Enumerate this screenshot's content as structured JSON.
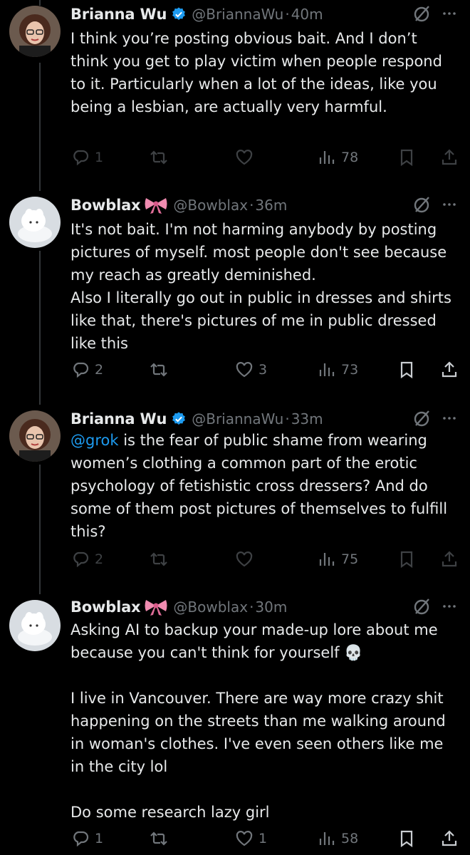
{
  "tweets": [
    {
      "name": "Brianna Wu",
      "verified": true,
      "bow": false,
      "handle": "@BriannaWu",
      "separator": "·",
      "time": "40m",
      "mention": "",
      "text": "I think you’re posting obvious bait. And I don’t think you get to play victim when people respond to it. Particularly when a lot of the ideas, like you being a lesbian, are actually very harmful.",
      "replies": "1",
      "retweets": "",
      "likes": "",
      "views": "78"
    },
    {
      "name": "Bowblax",
      "verified": false,
      "bow": true,
      "handle": "@Bowblax",
      "separator": "·",
      "time": "36m",
      "mention": "",
      "text": "It's not bait. I'm not harming anybody by posting pictures of myself. most people don't see because my reach as greatly deminished.\nAlso I literally go out in public in dresses and shirts like that, there's pictures of me in public dressed like this",
      "replies": "2",
      "retweets": "",
      "likes": "3",
      "views": "73"
    },
    {
      "name": "Brianna Wu",
      "verified": true,
      "bow": false,
      "handle": "@BriannaWu",
      "separator": "·",
      "time": "33m",
      "mention": "@grok",
      "text": " is the fear of public shame from wearing women’s clothing a common part of the erotic psychology of fetishistic cross dressers? And do some of them post pictures of themselves to fulfill this?",
      "replies": "2",
      "retweets": "",
      "likes": "",
      "views": "75"
    },
    {
      "name": "Bowblax",
      "verified": false,
      "bow": true,
      "handle": "@Bowblax",
      "separator": "·",
      "time": "30m",
      "mention": "",
      "text": "Asking AI to backup your made-up lore about me because you can't think for yourself 💀\n\nI live in Vancouver. There are way more crazy shit happening on the streets than me walking around in woman's clothes. I've even seen others like me in the city lol\n\nDo some research lazy girl",
      "replies": "1",
      "retweets": "",
      "likes": "1",
      "views": "58"
    }
  ],
  "colors": {
    "background": "#000000",
    "text": "#e7e9ea",
    "muted": "#71767b",
    "link": "#1d9bf0",
    "verified": "#1d9bf0",
    "bow": "#f08bb0"
  },
  "icons": [
    "reply-icon",
    "retweet-icon",
    "like-icon",
    "views-icon",
    "bookmark-icon",
    "share-icon",
    "grok-icon",
    "more-icon",
    "verified-icon",
    "bow-emoji"
  ]
}
